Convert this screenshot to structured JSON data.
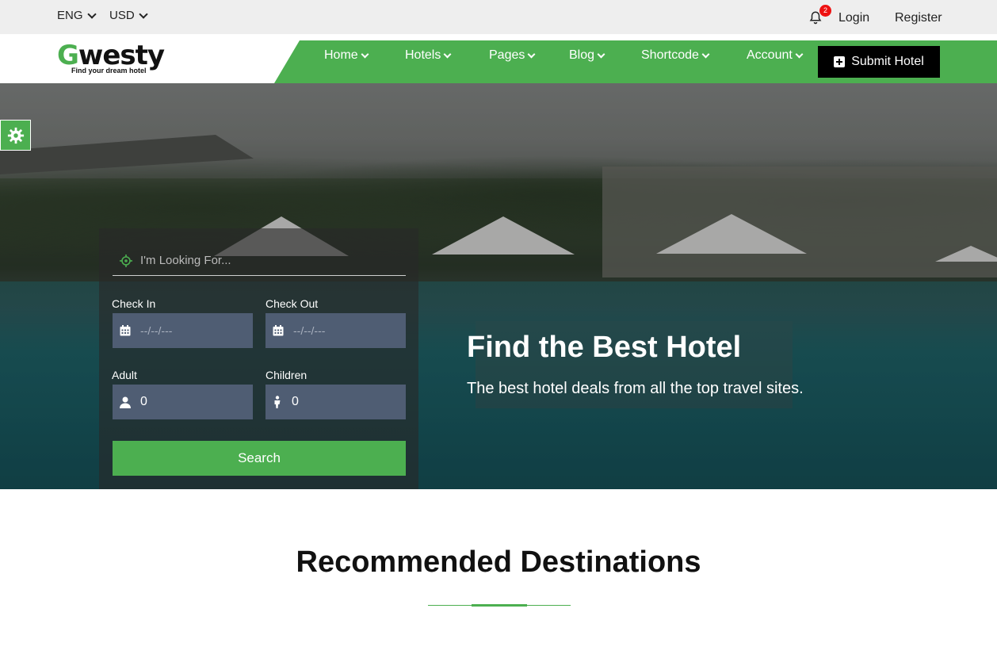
{
  "topbar": {
    "language": "ENG",
    "currency": "USD",
    "notification_count": "2",
    "login": "Login",
    "register": "Register"
  },
  "header": {
    "logo_text": "Gwesty",
    "logo_first": "G",
    "logo_rest": "westy",
    "logo_tagline": "Find your dream hotel",
    "nav": [
      "Home",
      "Hotels",
      "Pages",
      "Blog",
      "Shortcode",
      "Account"
    ],
    "submit_label": "Submit Hotel"
  },
  "search": {
    "placeholder": "I'm Looking For...",
    "check_in_label": "Check In",
    "check_out_label": "Check Out",
    "date_placeholder": "--/--/---",
    "adult_label": "Adult",
    "children_label": "Children",
    "adult_value": "0",
    "children_value": "0",
    "button_label": "Search"
  },
  "hero": {
    "title": "Find the Best Hotel",
    "subtitle": "The best hotel deals from all the top travel sites."
  },
  "section": {
    "title": "Recommended Destinations"
  },
  "colors": {
    "accent": "#4caf50",
    "dark": "#000000",
    "field_bg": "#4f5d73"
  }
}
